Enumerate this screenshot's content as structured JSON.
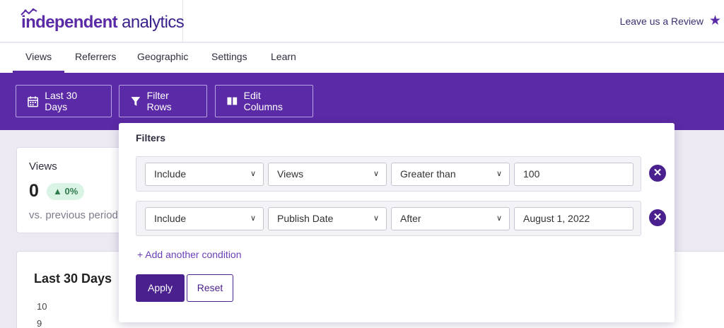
{
  "header": {
    "logo_bold": "independent",
    "logo_light": " analytics",
    "review_label": "Leave us a Review",
    "review_icon": "star-icon"
  },
  "tabs": [
    {
      "label": "Views",
      "active": true
    },
    {
      "label": "Referrers"
    },
    {
      "label": "Geographic"
    },
    {
      "label": "Settings"
    },
    {
      "label": "Learn"
    }
  ],
  "toolbar": {
    "date_range": {
      "label": "Last 30 Days",
      "icon": "calendar-icon"
    },
    "filter_rows": {
      "label": "Filter Rows",
      "icon": "funnel-icon"
    },
    "edit_columns": {
      "label": "Edit Columns",
      "icon": "columns-icon"
    }
  },
  "views_card": {
    "label": "Views",
    "value": "0",
    "change": "▲ 0%",
    "comparison": "vs. previous period"
  },
  "chart_card": {
    "title": "Last 30 Days",
    "yticks": [
      "10",
      "9"
    ]
  },
  "filters": {
    "title": "Filters",
    "conditions": [
      {
        "inclusion": "Include",
        "column": "Views",
        "operator": "Greater than",
        "value": "100"
      },
      {
        "inclusion": "Include",
        "column": "Publish Date",
        "operator": "After",
        "value": "August 1, 2022"
      }
    ],
    "add_label": "+ Add another condition",
    "apply_label": "Apply",
    "reset_label": "Reset"
  },
  "colors": {
    "brand": "#5b2aa6",
    "brand_dark": "#4a1f8e",
    "positive_bg": "#d9f4e4",
    "positive_text": "#2d7a4b"
  }
}
